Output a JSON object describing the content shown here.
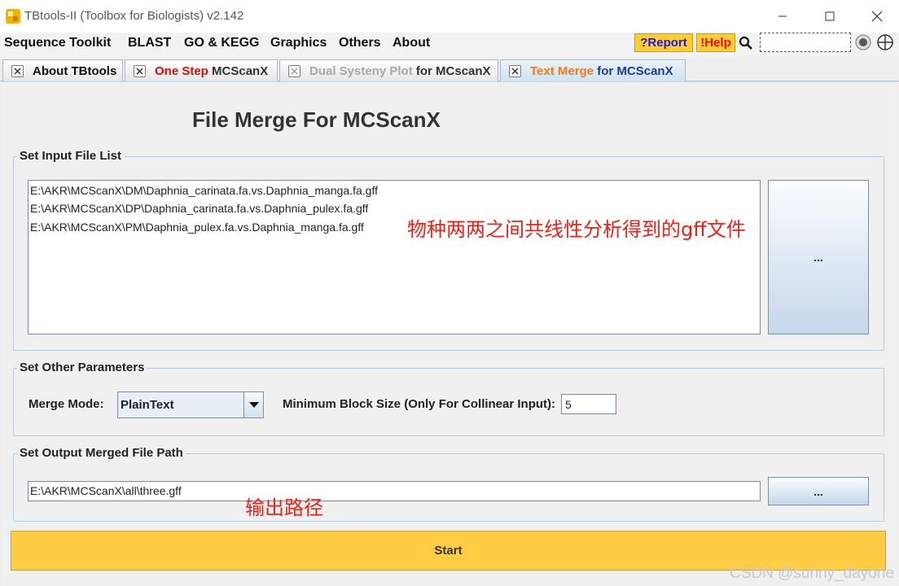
{
  "window": {
    "title": "TBtools-II (Toolbox for Biologists) v2.142"
  },
  "menu": {
    "items": [
      "Sequence Toolkit",
      "BLAST",
      "GO & KEGG",
      "Graphics",
      "Others",
      "About"
    ],
    "report_label": "?Report",
    "help_label": "!Help"
  },
  "tabs": [
    {
      "label_a": "About TBtools",
      "label_b": "",
      "color_a": "#111111"
    },
    {
      "label_a": "One Step ",
      "label_b": "MCScanX",
      "color_a": "#cc1111"
    },
    {
      "label_a": "Dual Systeny Plot ",
      "label_b": "for MCscanX",
      "color_a": "#a8a8a8"
    },
    {
      "label_a": "Text Merge ",
      "label_b": "for MCScanX",
      "color_a": "#ee7a1c"
    }
  ],
  "active_tab_index": 3,
  "page": {
    "title": "File Merge For MCScanX"
  },
  "input_group": {
    "title": "Set Input File List",
    "files": [
      "E:\\AKR\\MCScanX\\DM\\Daphnia_carinata.fa.vs.Daphnia_manga.fa.gff",
      "E:\\AKR\\MCScanX\\DP\\Daphnia_carinata.fa.vs.Daphnia_pulex.fa.gff",
      "E:\\AKR\\MCScanX\\PM\\Daphnia_pulex.fa.vs.Daphnia_manga.fa.gff"
    ],
    "browse_label": "..."
  },
  "params_group": {
    "title": "Set Other Parameters",
    "merge_mode_label": "Merge Mode:",
    "merge_mode_value": "PlainText",
    "min_block_label": "Minimum Block Size (Only For Collinear Input):",
    "min_block_value": "5"
  },
  "output_group": {
    "title": "Set Output Merged File Path",
    "path": "E:\\AKR\\MCScanX\\all\\three.gff",
    "browse_label": "..."
  },
  "start_label": "Start",
  "annotations": {
    "input_note": "物种两两之间共线性分析得到的gff文件",
    "output_note": "输出路径"
  },
  "watermark": "CSDN @sunny_dayone",
  "colors": {
    "accent_yellow": "#ffcc44",
    "annotation_red": "#e8221b",
    "help_blue": "#1a1adc",
    "help_red": "#e81010"
  }
}
